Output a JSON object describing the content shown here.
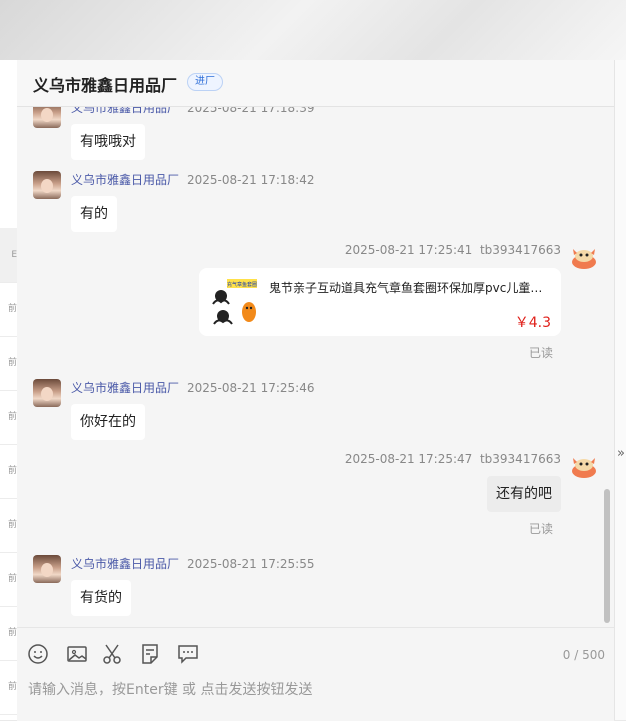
{
  "shop": {
    "name": "义乌市雅鑫日用品厂",
    "badge": "进厂"
  },
  "messages": [
    {
      "sender": "义乌市雅鑫日用品厂",
      "time": "2025-08-21 17:18:39",
      "text": "有哦哦对",
      "side": "left"
    },
    {
      "sender": "义乌市雅鑫日用品厂",
      "time": "2025-08-21 17:18:42",
      "text": "有的",
      "side": "left"
    },
    {
      "sender": "tb393417663",
      "time": "2025-08-21 17:25:41",
      "side": "right",
      "status": "已读",
      "product": {
        "title": "鬼节亲子互动道具充气章鱼套圈环保加厚pvc儿童万...",
        "price": "￥4.3",
        "thumb_caption": "充气章鱼套圈"
      }
    },
    {
      "sender": "义乌市雅鑫日用品厂",
      "time": "2025-08-21 17:25:46",
      "text": "你好在的",
      "side": "left"
    },
    {
      "sender": "tb393417663",
      "time": "2025-08-21 17:25:47",
      "text": "还有的吧",
      "side": "right",
      "status": "已读"
    },
    {
      "sender": "义乌市雅鑫日用品厂",
      "time": "2025-08-21 17:25:55",
      "text": "有货的",
      "side": "left"
    }
  ],
  "toolbar": {
    "icons": [
      "emoji-icon",
      "image-icon",
      "scissors-icon",
      "quick-reply-icon",
      "chat-bubble-icon"
    ],
    "counter": "0 / 500",
    "placeholder": "请输入消息，按Enter键 或 点击发送按钮发送"
  },
  "background": {
    "left_rows": [
      "E",
      "前",
      "前",
      "前",
      "前",
      "前",
      "前",
      "前",
      "前",
      "前"
    ],
    "expand_icon": "»"
  },
  "colors": {
    "accent_name": "#4a59a8",
    "price": "#e0201a",
    "badge": "#2f6fd8"
  }
}
